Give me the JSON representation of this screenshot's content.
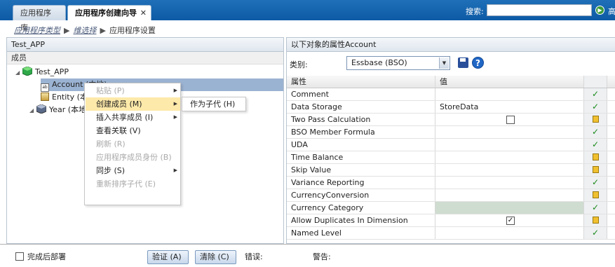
{
  "tabs": [
    {
      "label": "应用程序库"
    },
    {
      "label": "应用程序创建向导",
      "close": "✕"
    }
  ],
  "search": {
    "label": "搜索:",
    "value": "",
    "advanced": "高"
  },
  "breadcrumb": {
    "step1": "应用程序类型",
    "step2": "维选择",
    "step3": "应用程序设置"
  },
  "left_panel": {
    "title": "Test_APP",
    "members_header": "成员",
    "tree": [
      {
        "label": "Test_APP"
      },
      {
        "label": "Account (本地)"
      },
      {
        "label": "Entity (本地)"
      },
      {
        "label": "Year (本地)"
      }
    ]
  },
  "context_menu": {
    "items": [
      {
        "label": "粘贴 (P)",
        "disabled": true,
        "submenu": true
      },
      {
        "label": "创建成员 (M)",
        "disabled": false,
        "submenu": true,
        "active": true
      },
      {
        "label": "插入共享成员 (I)",
        "disabled": false,
        "submenu": true
      },
      {
        "label": "查看关联 (V)",
        "disabled": false
      },
      {
        "label": "刷新 (R)",
        "disabled": true
      },
      {
        "label": "应用程序成员身份 (B)",
        "disabled": true
      },
      {
        "label": "同步 (S)",
        "disabled": false,
        "submenu": true
      },
      {
        "label": "重新排序子代 (E)",
        "disabled": true
      }
    ],
    "submenu_item": "作为子代 (H)"
  },
  "right_panel": {
    "title": "以下对象的属性Account",
    "category_label": "类别:",
    "category_value": "Essbase (BSO)",
    "col_property": "属性",
    "col_value": "值",
    "properties": [
      {
        "name": "Comment",
        "value": "",
        "status": "check"
      },
      {
        "name": "Data Storage",
        "value": "StoreData",
        "status": "check"
      },
      {
        "name": "Two Pass Calculation",
        "value": "",
        "checkbox": "unchecked",
        "status": "inherit"
      },
      {
        "name": "BSO Member Formula",
        "value": "",
        "status": "check"
      },
      {
        "name": "UDA",
        "value": "",
        "status": "check"
      },
      {
        "name": "Time Balance",
        "value": "",
        "status": "inherit"
      },
      {
        "name": "Skip Value",
        "value": "",
        "status": "inherit"
      },
      {
        "name": "Variance Reporting",
        "value": "",
        "status": "check"
      },
      {
        "name": "CurrencyConversion",
        "value": "",
        "status": "inherit"
      },
      {
        "name": "Currency Category",
        "value": "",
        "shaded": true,
        "status": "check"
      },
      {
        "name": "Allow Duplicates In Dimension",
        "value": "",
        "checkbox": "checked",
        "status": "inherit"
      },
      {
        "name": "Named Level",
        "value": "",
        "status": "check"
      }
    ]
  },
  "bottom": {
    "deploy_label": "完成后部署",
    "validate_label": "验证 (A)",
    "remove_label": "清除 (C)",
    "errors_label": "错误:",
    "warnings_label": "警告:"
  },
  "colors": {
    "topbar": "#0d5aa5",
    "selection": "#9bb3d2",
    "menu_active": "#fde9a9",
    "check": "#1b8a1b"
  }
}
